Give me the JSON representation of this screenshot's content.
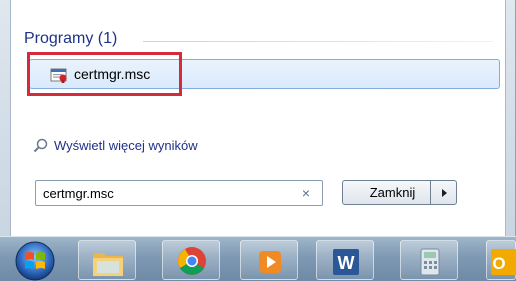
{
  "start_menu": {
    "section_header": "Programy (1)",
    "result": {
      "label": "certmgr.msc",
      "icon": "certificate-manager-icon"
    },
    "see_more_label": "Wyświetl więcej wyników",
    "search": {
      "value": "certmgr.msc",
      "clear_glyph": "×"
    },
    "close_button_label": "Zamknij"
  },
  "highlight_color": "#d22b3b",
  "taskbar": {
    "start_icon": "windows-orb-icon",
    "pinned": [
      "explorer-icon",
      "chrome-icon",
      "media-player-icon",
      "word-icon",
      "calculator-icon",
      "outlook-icon"
    ]
  }
}
